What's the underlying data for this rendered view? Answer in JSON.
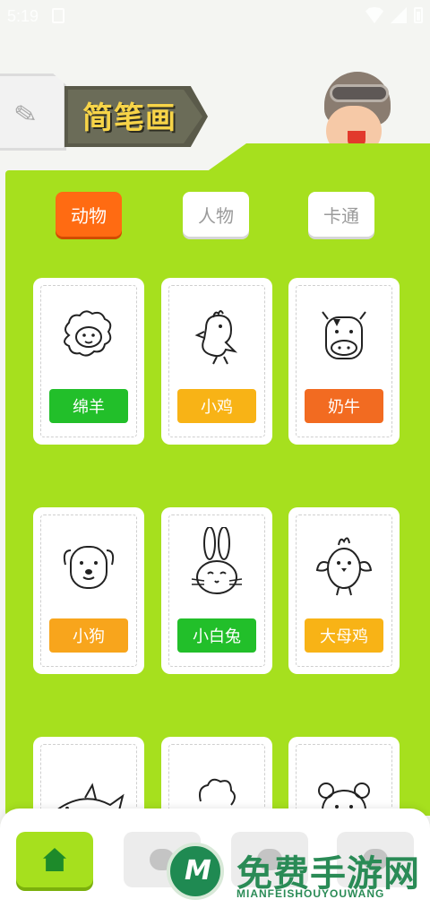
{
  "status_bar": {
    "time": "5:19"
  },
  "header": {
    "title": "简笔画"
  },
  "tabs": [
    {
      "label": "动物",
      "active": true
    },
    {
      "label": "人物",
      "active": false
    },
    {
      "label": "卡通",
      "active": false
    }
  ],
  "cards": [
    {
      "label": "绵羊",
      "icon": "sheep-icon",
      "color": "#22bf2a"
    },
    {
      "label": "小鸡",
      "icon": "chick-icon",
      "color": "#f8b316"
    },
    {
      "label": "奶牛",
      "icon": "cow-icon",
      "color": "#f26b21"
    },
    {
      "label": "小狗",
      "icon": "dog-icon",
      "color": "#f8a51c"
    },
    {
      "label": "小白兔",
      "icon": "rabbit-icon",
      "color": "#22bf2a"
    },
    {
      "label": "大母鸡",
      "icon": "hen-icon",
      "color": "#f8b316"
    }
  ],
  "bottom_nav": {
    "items": [
      "home-icon",
      "chat-icon",
      "chat-icon",
      "chat-icon"
    ]
  },
  "watermark": {
    "title": "免费手游网",
    "subtitle": "MIANFEISHOUYOUWANG"
  },
  "colors": {
    "panel": "#a6e01e",
    "active_tab": "#ff6b12"
  }
}
